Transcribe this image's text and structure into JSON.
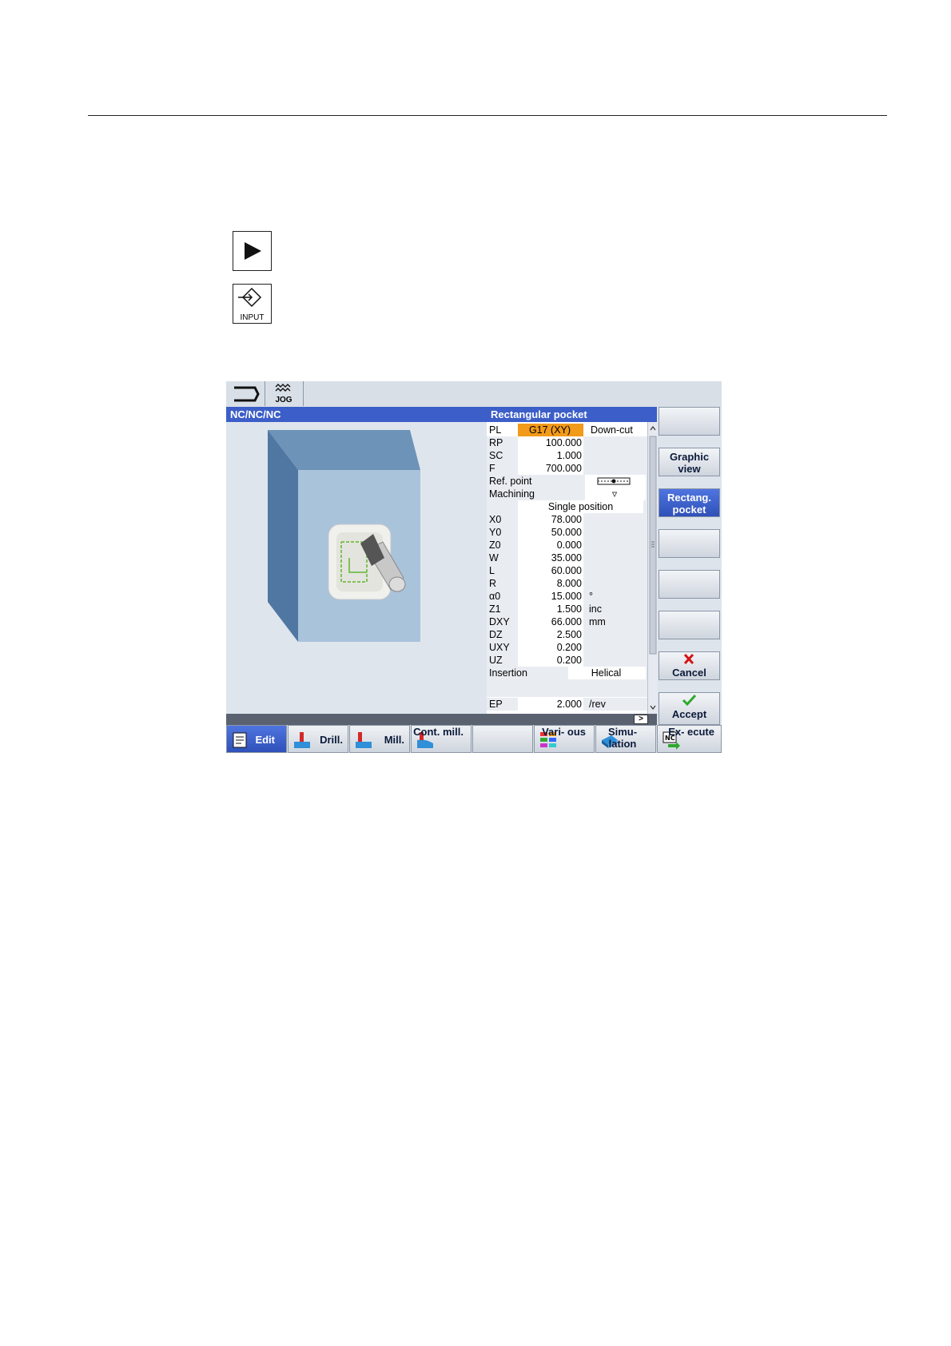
{
  "keys": {
    "cycle_start_label": "",
    "input_label": "INPUT"
  },
  "screen": {
    "jog_label": "JOG",
    "left_header": "NC/NC/NC",
    "right_header": "Rectangular pocket",
    "params": [
      {
        "label": "PL",
        "value": "G17 (XY)",
        "unit": "Down-cut",
        "highlight": true
      },
      {
        "label": "RP",
        "value": "100.000",
        "unit": ""
      },
      {
        "label": "SC",
        "value": "1.000",
        "unit": ""
      },
      {
        "label": "F",
        "value": "700.000",
        "unit": ""
      },
      {
        "label": "Ref. point",
        "value": "",
        "unit": ""
      },
      {
        "label": "Machining",
        "value": "",
        "unit": "▿"
      },
      {
        "label": "",
        "value": "Single position",
        "unit": ""
      },
      {
        "label": "X0",
        "value": "78.000",
        "unit": ""
      },
      {
        "label": "Y0",
        "value": "50.000",
        "unit": ""
      },
      {
        "label": "Z0",
        "value": "0.000",
        "unit": ""
      },
      {
        "label": "W",
        "value": "35.000",
        "unit": ""
      },
      {
        "label": "L",
        "value": "60.000",
        "unit": ""
      },
      {
        "label": "R",
        "value": "8.000",
        "unit": ""
      },
      {
        "label": "α0",
        "value": "15.000",
        "unit": "°"
      },
      {
        "label": "Z1",
        "value": "1.500",
        "unit": "inc"
      },
      {
        "label": "DXY",
        "value": "66.000",
        "unit": "mm"
      },
      {
        "label": "DZ",
        "value": "2.500",
        "unit": ""
      },
      {
        "label": "UXY",
        "value": "0.200",
        "unit": ""
      },
      {
        "label": "UZ",
        "value": "0.200",
        "unit": ""
      },
      {
        "label": "Insertion",
        "value": "Helical",
        "unit": ""
      },
      {
        "label": "EP",
        "value": "2.000",
        "unit": "/rev"
      }
    ],
    "right_softkeys": [
      "",
      "Graphic view",
      "Rectang. pocket",
      "",
      "",
      "",
      "Cancel",
      "Accept"
    ],
    "bottom_softkeys": [
      "Edit",
      "Drill.",
      "Mill.",
      "Cont. mill.",
      "",
      "Vari- ous",
      "Simu- lation",
      "Ex- ecute"
    ],
    "scroll_right": ">"
  }
}
